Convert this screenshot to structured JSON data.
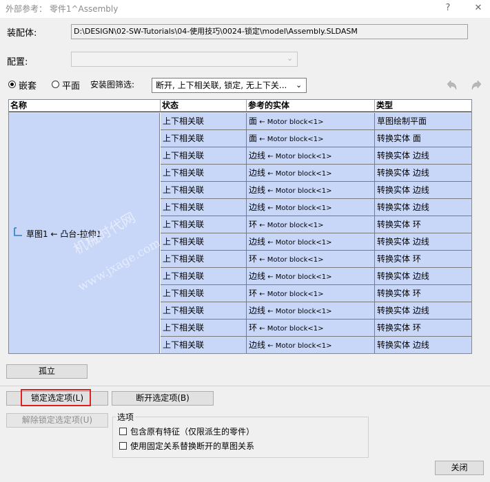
{
  "window": {
    "title": "外部参考： 零件1^Assembly"
  },
  "assembly": {
    "label": "装配体:",
    "path": "D:\\DESIGN\\02-SW-Tutorials\\04-使用技巧\\0024-锁定\\model\\Assembly.SLDASM"
  },
  "config": {
    "label": "配置:",
    "value": ""
  },
  "view": {
    "nested_label": "嵌套",
    "flat_label": "平面",
    "filter_label": "安装图筛选:",
    "filter_value": "断开, 上下相关联, 锁定, 无上下关..."
  },
  "table": {
    "headers": [
      "名称",
      "状态",
      "参考的实体",
      "类型"
    ],
    "name_value": "草图1 ← 凸台-拉伸1",
    "rows": [
      {
        "status": "上下相关联",
        "ref_type": "面",
        "ref_entity": "Motor block<1>",
        "kind": "草图绘制平面"
      },
      {
        "status": "上下相关联",
        "ref_type": "面",
        "ref_entity": "Motor block<1>",
        "kind": "转换实体 面"
      },
      {
        "status": "上下相关联",
        "ref_type": "边线",
        "ref_entity": "Motor block<1>",
        "kind": "转换实体 边线"
      },
      {
        "status": "上下相关联",
        "ref_type": "边线",
        "ref_entity": "Motor block<1>",
        "kind": "转换实体 边线"
      },
      {
        "status": "上下相关联",
        "ref_type": "边线",
        "ref_entity": "Motor block<1>",
        "kind": "转换实体 边线"
      },
      {
        "status": "上下相关联",
        "ref_type": "边线",
        "ref_entity": "Motor block<1>",
        "kind": "转换实体 边线"
      },
      {
        "status": "上下相关联",
        "ref_type": "环",
        "ref_entity": "Motor block<1>",
        "kind": "转换实体 环"
      },
      {
        "status": "上下相关联",
        "ref_type": "边线",
        "ref_entity": "Motor block<1>",
        "kind": "转换实体 边线"
      },
      {
        "status": "上下相关联",
        "ref_type": "环",
        "ref_entity": "Motor block<1>",
        "kind": "转换实体 环"
      },
      {
        "status": "上下相关联",
        "ref_type": "边线",
        "ref_entity": "Motor block<1>",
        "kind": "转换实体 边线"
      },
      {
        "status": "上下相关联",
        "ref_type": "环",
        "ref_entity": "Motor block<1>",
        "kind": "转换实体 环"
      },
      {
        "status": "上下相关联",
        "ref_type": "边线",
        "ref_entity": "Motor block<1>",
        "kind": "转换实体 边线"
      },
      {
        "status": "上下相关联",
        "ref_type": "环",
        "ref_entity": "Motor block<1>",
        "kind": "转换实体 环"
      },
      {
        "status": "上下相关联",
        "ref_type": "边线",
        "ref_entity": "Motor block<1>",
        "kind": "转换实体 边线"
      }
    ]
  },
  "watermark": {
    "line1": "机械时代网",
    "line2": "www.jxage.com"
  },
  "buttons": {
    "isolate": "孤立",
    "lock": "锁定选定项(L)",
    "break": "断开选定项(B)",
    "unlock": "解除锁定选定项(U)",
    "close": "关闭"
  },
  "options": {
    "title": "选项",
    "include_features": "包含原有特征（仅限派生的零件）",
    "use_fixed": "使用固定关系替换断开的草图关系"
  },
  "colors": {
    "row_fill": "#c8d6f8",
    "highlight": "#e02020"
  }
}
